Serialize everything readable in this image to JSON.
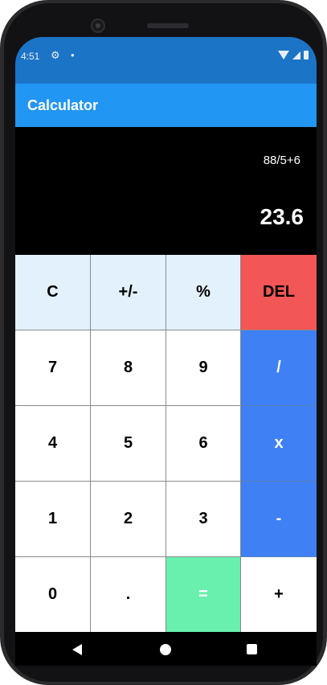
{
  "status_bar": {
    "time": "4:51",
    "icons": [
      "gear-icon",
      "dot-icon",
      "wifi-icon",
      "signal-icon",
      "battery-icon"
    ]
  },
  "app_bar": {
    "title": "Calculator"
  },
  "display": {
    "expression": "88/5+6",
    "result": "23.6"
  },
  "keypad": {
    "keys": [
      {
        "label": "C",
        "kind": "func"
      },
      {
        "label": "+/-",
        "kind": "func"
      },
      {
        "label": "%",
        "kind": "func"
      },
      {
        "label": "DEL",
        "kind": "del"
      },
      {
        "label": "7",
        "kind": "num"
      },
      {
        "label": "8",
        "kind": "num"
      },
      {
        "label": "9",
        "kind": "num"
      },
      {
        "label": "/",
        "kind": "op"
      },
      {
        "label": "4",
        "kind": "num"
      },
      {
        "label": "5",
        "kind": "num"
      },
      {
        "label": "6",
        "kind": "num"
      },
      {
        "label": "x",
        "kind": "op"
      },
      {
        "label": "1",
        "kind": "num"
      },
      {
        "label": "2",
        "kind": "num"
      },
      {
        "label": "3",
        "kind": "num"
      },
      {
        "label": "-",
        "kind": "op"
      },
      {
        "label": "0",
        "kind": "num"
      },
      {
        "label": ".",
        "kind": "num"
      },
      {
        "label": "=",
        "kind": "eq"
      },
      {
        "label": "+",
        "kind": "plus"
      }
    ]
  },
  "colors": {
    "status_bar": "#1b74c6",
    "app_bar": "#2196f3",
    "func_key": "#e3f1fc",
    "del_key": "#f25656",
    "op_key": "#3f80f4",
    "equals_key": "#69f0ae"
  },
  "nav_bar": {
    "icons": [
      "back-icon",
      "home-icon",
      "recents-icon"
    ]
  }
}
